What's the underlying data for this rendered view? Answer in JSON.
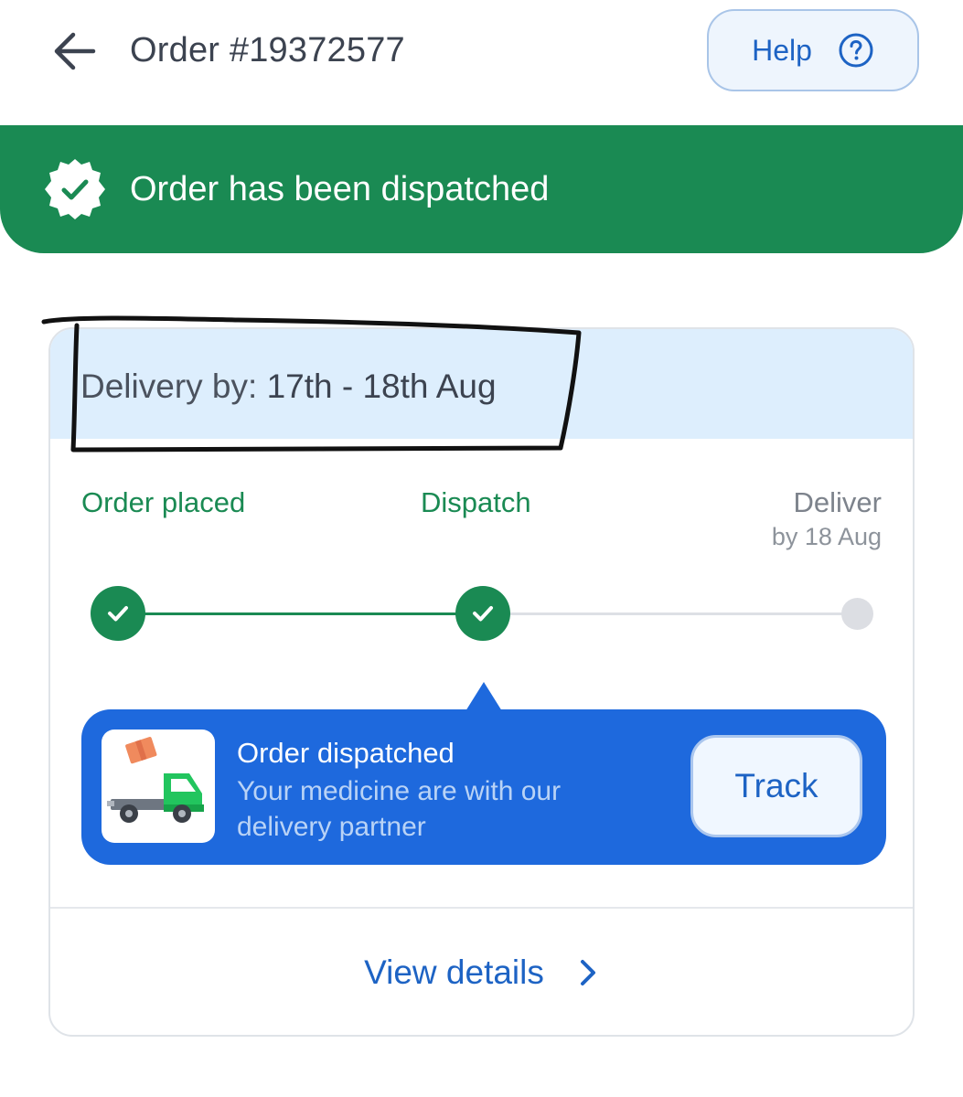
{
  "header": {
    "title": "Order #19372577",
    "help_label": "Help"
  },
  "banner": {
    "text": "Order has been dispatched"
  },
  "card": {
    "delivery_prefix": "Delivery by:",
    "delivery_date": "17th - 18th Aug",
    "steps": [
      {
        "label": "Order placed",
        "status": "done"
      },
      {
        "label": "Dispatch",
        "status": "done"
      },
      {
        "label": "Deliver",
        "sub": "by 18 Aug",
        "status": "pending"
      }
    ],
    "dispatch": {
      "title": "Order dispatched",
      "subtitle": "Your medicine are with our delivery partner",
      "track_label": "Track"
    },
    "view_details_label": "View details"
  },
  "colors": {
    "brand_green": "#1a8a53",
    "brand_blue": "#1e69dd",
    "link_blue": "#1d63c4"
  }
}
